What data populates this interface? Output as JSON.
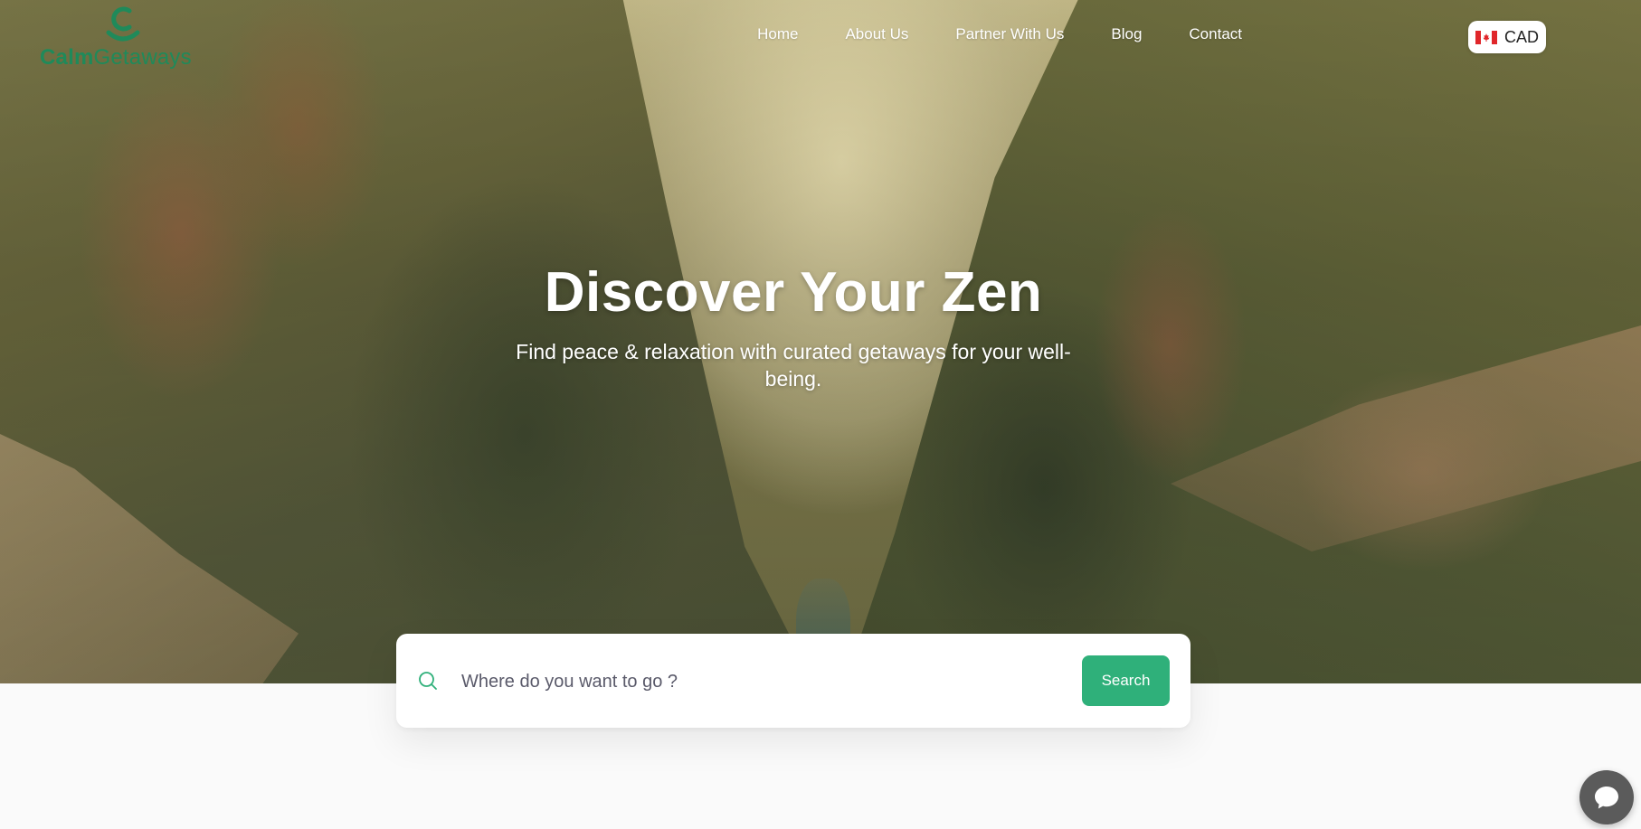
{
  "brand": {
    "name_bold": "Calm",
    "name_light": "Getaways",
    "logo_icon": "swirl-c-logo-icon",
    "color": "#1f8a5a"
  },
  "nav": {
    "items": [
      {
        "label": "Home"
      },
      {
        "label": "About Us"
      },
      {
        "label": "Partner With Us"
      },
      {
        "label": "Blog"
      },
      {
        "label": "Contact"
      }
    ]
  },
  "currency": {
    "code": "CAD",
    "flag_icon": "canada-flag-icon"
  },
  "hero": {
    "headline": "Discover Your Zen",
    "subheadline": "Find peace & relaxation with curated getaways for your well-being."
  },
  "search": {
    "placeholder": "Where do you want to go ?",
    "value": "",
    "button_label": "Search",
    "icon": "search-icon",
    "accent": "#2fb07a"
  },
  "chat": {
    "icon": "chat-bubble-icon"
  }
}
